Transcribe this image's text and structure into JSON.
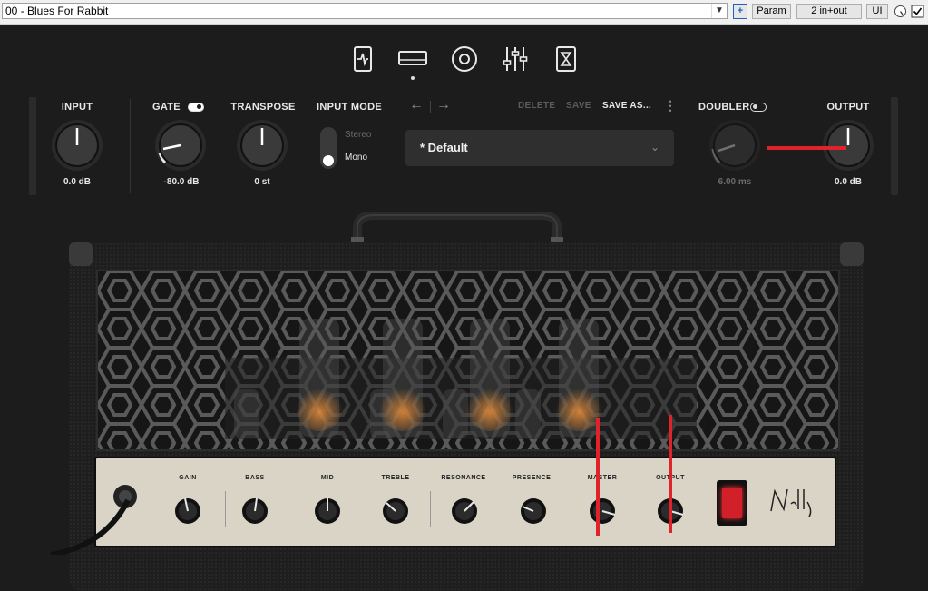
{
  "host": {
    "preset_name": "00 - Blues For Rabbit",
    "plus_label": "+",
    "param_label": "Param",
    "io_label": "2 in+out",
    "ui_label": "UI"
  },
  "nav": {
    "icons": [
      "tuner-icon",
      "amp-icon",
      "cabinet-icon",
      "eq-sliders-icon",
      "metronome-icon"
    ]
  },
  "controls": {
    "input": {
      "label": "INPUT",
      "value": "0.0 dB"
    },
    "gate": {
      "label": "GATE",
      "value": "-80.0 dB",
      "enabled": true
    },
    "transpose": {
      "label": "TRANSPOSE",
      "value": "0 st"
    },
    "input_mode": {
      "label": "INPUT MODE",
      "options": [
        "Stereo",
        "Mono"
      ],
      "selected": "Mono"
    },
    "doubler": {
      "label": "DOUBLER",
      "value": "6.00 ms",
      "enabled": false
    },
    "output": {
      "label": "OUTPUT",
      "value": "0.0 dB"
    }
  },
  "preset": {
    "back_arrow": "←",
    "forward_arrow": "→",
    "delete_label": "DELETE",
    "save_label": "SAVE",
    "save_as_label": "SAVE AS...",
    "more_label": "⋮",
    "current": "* Default"
  },
  "amp_controls": [
    {
      "label": "GAIN"
    },
    {
      "label": "BASS"
    },
    {
      "label": "MID"
    },
    {
      "label": "TREBLE"
    },
    {
      "label": "RESONANCE"
    },
    {
      "label": "PRESENCE"
    },
    {
      "label": "MASTER"
    },
    {
      "label": "OUTPUT"
    }
  ],
  "colors": {
    "accent_red": "#e0222b",
    "panel_bg": "#1c1c1c",
    "faceplate": "#d9d4c6"
  }
}
